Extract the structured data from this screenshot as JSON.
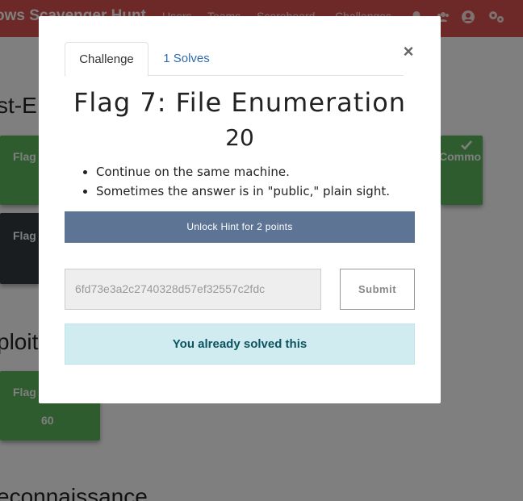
{
  "navbar": {
    "brand": "ows Scavenger Hunt",
    "links": [
      "Users",
      "Teams",
      "Scoreboard",
      "Challenges"
    ]
  },
  "background": {
    "sections": [
      "st-E",
      "ploit",
      "econnaissance"
    ],
    "tiles": [
      {
        "label": "Flag",
        "state": "solved"
      },
      {
        "label": "Commo",
        "state": "solved"
      },
      {
        "label": "Flag",
        "state": "unsolved"
      },
      {
        "label": "Flag",
        "value": "60",
        "state": "solved"
      }
    ]
  },
  "modal": {
    "tabs": [
      "Challenge",
      "1 Solves"
    ],
    "close": "×",
    "title": "Flag 7: File Enumeration",
    "value": "20",
    "description": [
      "Continue on the same machine.",
      "Sometimes the answer is in \"public,\" plain sight."
    ],
    "hint_button": "Unlock Hint for 2 points",
    "flag_input": {
      "value": "6fd73e3a2c2740328d57ef32557c2fdc"
    },
    "submit": "Submit",
    "solved_message": "You already solved this"
  },
  "colors": {
    "navbar": "#d9534f",
    "hint_button": "#5e7494",
    "solved_alert_bg": "#d1ecf1",
    "solved_alert_text": "#0c5460",
    "tile_solved": "#5cb85c",
    "tile_unsolved": "#343a40"
  }
}
